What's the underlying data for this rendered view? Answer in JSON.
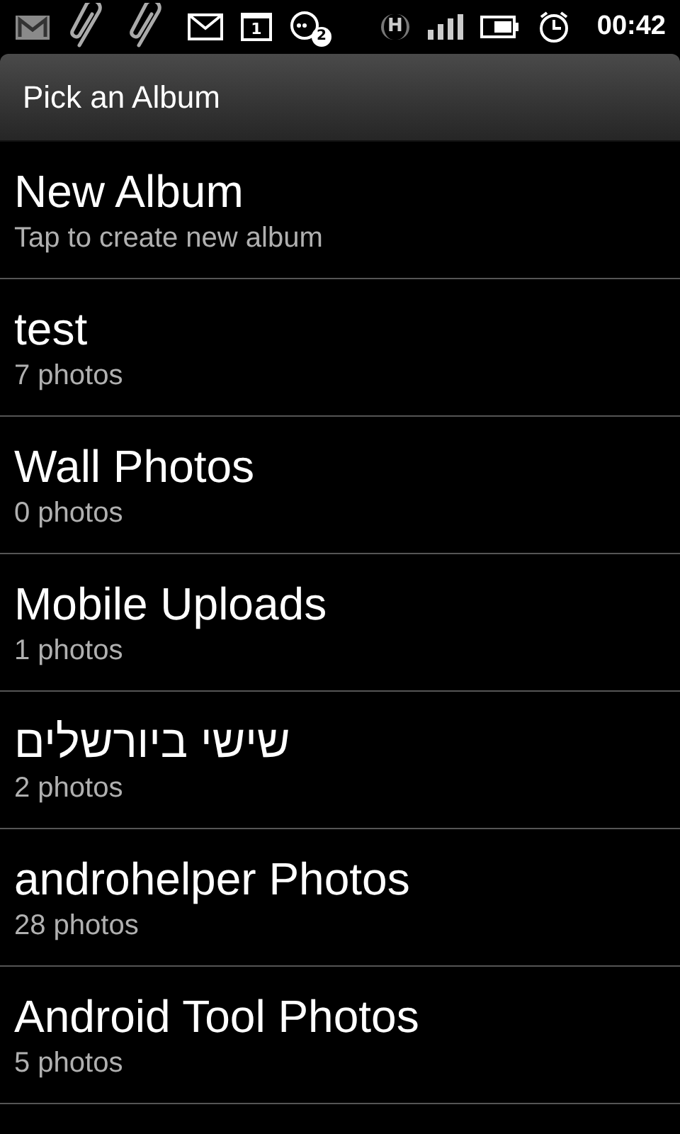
{
  "status_bar": {
    "calendar_day": "1",
    "chat_badge": "2",
    "network_type": "H",
    "time": "00:42"
  },
  "title_bar": {
    "title": "Pick an Album"
  },
  "albums": [
    {
      "title": "New Album",
      "subtitle": "Tap to create new album"
    },
    {
      "title": "test",
      "subtitle": "7 photos"
    },
    {
      "title": "Wall Photos",
      "subtitle": "0 photos"
    },
    {
      "title": "Mobile Uploads",
      "subtitle": "1 photos"
    },
    {
      "title": "שישי ביורשלים",
      "subtitle": "2 photos"
    },
    {
      "title": "androhelper Photos",
      "subtitle": "28 photos"
    },
    {
      "title": "Android Tool Photos",
      "subtitle": "5 photos"
    }
  ]
}
